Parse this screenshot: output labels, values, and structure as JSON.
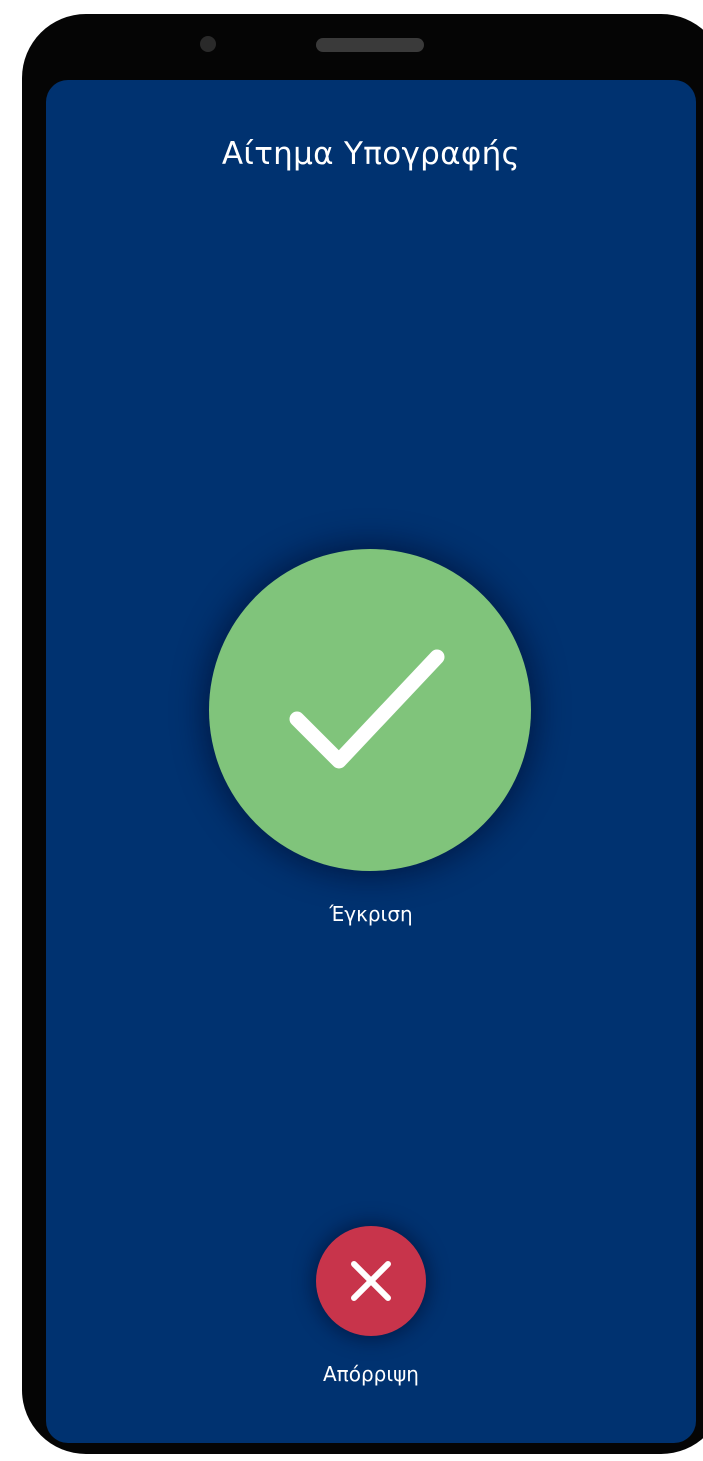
{
  "screen": {
    "title": "Αίτημα Υπογραφής",
    "background_color": "#003270"
  },
  "approve": {
    "label": "Έγκριση",
    "icon": "checkmark-icon",
    "color": "#80c47b"
  },
  "reject": {
    "label": "Απόρριψη",
    "icon": "close-icon",
    "color": "#c8344b"
  }
}
